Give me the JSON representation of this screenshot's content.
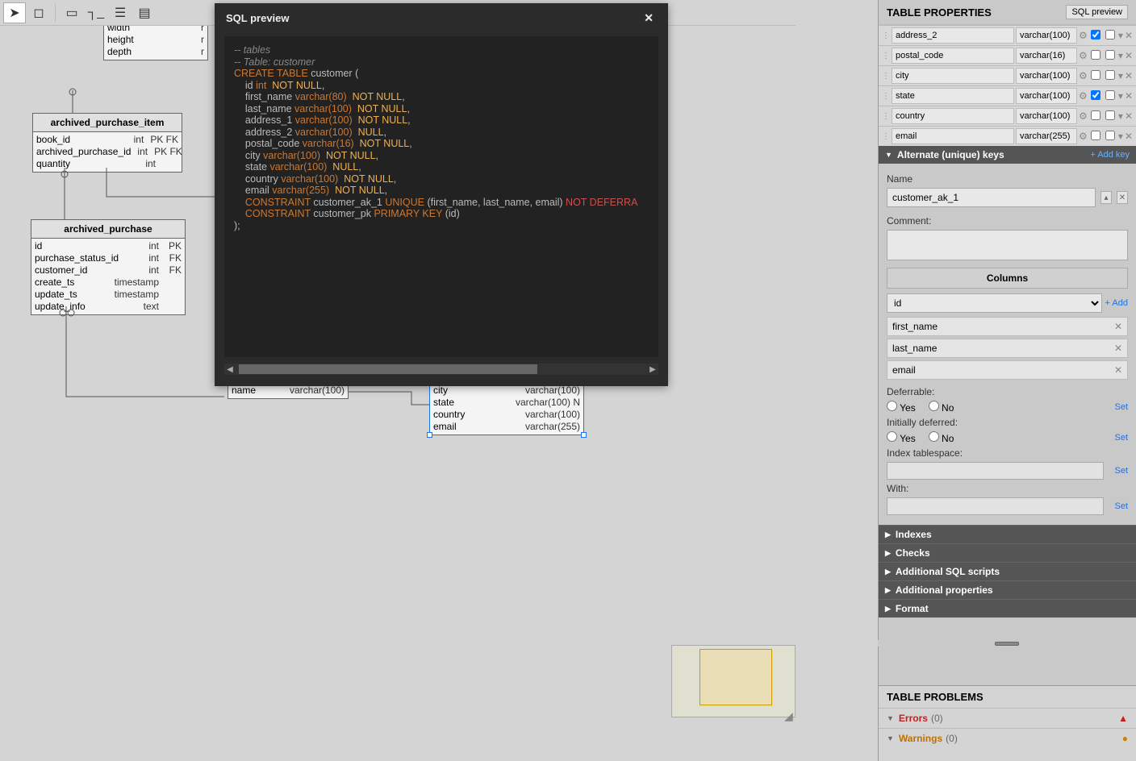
{
  "toolbar": {
    "tools": [
      "pointer",
      "marquee",
      "separator",
      "box",
      "connector",
      "list",
      "document"
    ]
  },
  "modal": {
    "title": "SQL preview",
    "code_lines": [
      {
        "t": "-- tables",
        "cls": "c-gray"
      },
      {
        "t": "-- Table: customer",
        "cls": "c-gray"
      },
      {
        "segments": [
          [
            "CREATE TABLE",
            "c-orange"
          ],
          [
            " ",
            ""
          ],
          [
            "customer (",
            "c-light"
          ]
        ]
      },
      {
        "segments": [
          [
            "    id ",
            "c-light"
          ],
          [
            "int",
            "c-orange"
          ],
          [
            "  ",
            ""
          ],
          [
            "NOT NULL",
            "c-yellow"
          ],
          [
            ",",
            "c-light"
          ]
        ]
      },
      {
        "segments": [
          [
            "    first_name ",
            "c-light"
          ],
          [
            "varchar(80)",
            "c-orange"
          ],
          [
            "  ",
            ""
          ],
          [
            "NOT NULL",
            "c-yellow"
          ],
          [
            ",",
            "c-light"
          ]
        ]
      },
      {
        "segments": [
          [
            "    last_name ",
            "c-light"
          ],
          [
            "varchar(100)",
            "c-orange"
          ],
          [
            "  ",
            ""
          ],
          [
            "NOT NULL",
            "c-yellow"
          ],
          [
            ",",
            "c-light"
          ]
        ]
      },
      {
        "segments": [
          [
            "    address_1 ",
            "c-light"
          ],
          [
            "varchar(100)",
            "c-orange"
          ],
          [
            "  ",
            ""
          ],
          [
            "NOT NULL",
            "c-yellow"
          ],
          [
            ",",
            "c-light"
          ]
        ]
      },
      {
        "segments": [
          [
            "    address_2 ",
            "c-light"
          ],
          [
            "varchar(100)",
            "c-orange"
          ],
          [
            "  ",
            ""
          ],
          [
            "NULL",
            "c-yellow"
          ],
          [
            ",",
            "c-light"
          ]
        ]
      },
      {
        "segments": [
          [
            "    postal_code ",
            "c-light"
          ],
          [
            "varchar(16)",
            "c-orange"
          ],
          [
            "  ",
            ""
          ],
          [
            "NOT NULL",
            "c-yellow"
          ],
          [
            ",",
            "c-light"
          ]
        ]
      },
      {
        "segments": [
          [
            "    city ",
            "c-light"
          ],
          [
            "varchar(100)",
            "c-orange"
          ],
          [
            "  ",
            ""
          ],
          [
            "NOT NULL",
            "c-yellow"
          ],
          [
            ",",
            "c-light"
          ]
        ]
      },
      {
        "segments": [
          [
            "    state ",
            "c-light"
          ],
          [
            "varchar(100)",
            "c-orange"
          ],
          [
            "  ",
            ""
          ],
          [
            "NULL",
            "c-yellow"
          ],
          [
            ",",
            "c-light"
          ]
        ]
      },
      {
        "segments": [
          [
            "    country ",
            "c-light"
          ],
          [
            "varchar(100)",
            "c-orange"
          ],
          [
            "  ",
            ""
          ],
          [
            "NOT NULL",
            "c-yellow"
          ],
          [
            ",",
            "c-light"
          ]
        ]
      },
      {
        "segments": [
          [
            "    email ",
            "c-light"
          ],
          [
            "varchar(255)",
            "c-orange"
          ],
          [
            "  ",
            ""
          ],
          [
            "NOT NULL",
            "c-yellow"
          ],
          [
            ",",
            "c-light"
          ]
        ]
      },
      {
        "segments": [
          [
            "    ",
            ""
          ],
          [
            "CONSTRAINT",
            "c-orange"
          ],
          [
            " customer_ak_1 ",
            "c-light"
          ],
          [
            "UNIQUE",
            "c-orange"
          ],
          [
            " (first_name, last_name, email) ",
            "c-light"
          ],
          [
            "NOT DEFERRA",
            "c-red"
          ]
        ]
      },
      {
        "segments": [
          [
            "    ",
            ""
          ],
          [
            "CONSTRAINT",
            "c-orange"
          ],
          [
            " customer_pk ",
            "c-light"
          ],
          [
            "PRIMARY KEY",
            "c-orange"
          ],
          [
            " (id)",
            "c-light"
          ]
        ]
      },
      {
        "t": ");",
        "cls": "c-light"
      }
    ]
  },
  "entities": {
    "partial_top": {
      "rows": [
        [
          "width",
          "r"
        ],
        [
          "height",
          "r"
        ],
        [
          "depth",
          "r"
        ]
      ]
    },
    "api": {
      "title": "archived_purchase_item",
      "rows": [
        [
          "book_id",
          "int",
          "PK FK"
        ],
        [
          "archived_purchase_id",
          "int",
          "PK FK"
        ],
        [
          "quantity",
          "int",
          ""
        ]
      ]
    },
    "ap": {
      "title": "archived_purchase",
      "rows": [
        [
          "id",
          "int",
          "PK"
        ],
        [
          "purchase_status_id",
          "int",
          "FK"
        ],
        [
          "customer_id",
          "int",
          "FK"
        ],
        [
          "create_ts",
          "timestamp",
          ""
        ],
        [
          "update_ts",
          "timestamp",
          ""
        ],
        [
          "update_info",
          "text",
          ""
        ]
      ]
    },
    "fragment1": {
      "rows": [
        [
          "name",
          "varchar(100)"
        ]
      ]
    },
    "fragment2": {
      "rows": [
        [
          "city",
          "varchar(100)"
        ],
        [
          "state",
          "varchar(100) N"
        ],
        [
          "country",
          "varchar(100)"
        ],
        [
          "email",
          "varchar(255)"
        ]
      ]
    }
  },
  "panel": {
    "title": "TABLE PROPERTIES",
    "sql_preview_btn": "SQL preview",
    "columns": [
      {
        "name": "address_2",
        "type": "varchar(100)",
        "pk": true,
        "nn": false
      },
      {
        "name": "postal_code",
        "type": "varchar(16)",
        "pk": false,
        "nn": false
      },
      {
        "name": "city",
        "type": "varchar(100)",
        "pk": false,
        "nn": false
      },
      {
        "name": "state",
        "type": "varchar(100)",
        "pk": true,
        "nn": false
      },
      {
        "name": "country",
        "type": "varchar(100)",
        "pk": false,
        "nn": false
      },
      {
        "name": "email",
        "type": "varchar(255)",
        "pk": false,
        "nn": false
      }
    ],
    "ak_section": "Alternate (unique) keys",
    "add_key": "+ Add key",
    "name_label": "Name",
    "name_value": "customer_ak_1",
    "comment_label": "Comment:",
    "columns_hdr": "Columns",
    "col_select": "id",
    "add": "+ Add",
    "selected_cols": [
      "first_name",
      "last_name",
      "email"
    ],
    "deferrable_label": "Deferrable:",
    "initially_label": "Initially deferred:",
    "yes": "Yes",
    "no": "No",
    "set": "Set",
    "index_ts_label": "Index tablespace:",
    "with_label": "With:",
    "sections": [
      "Indexes",
      "Checks",
      "Additional SQL scripts",
      "Additional properties",
      "Format"
    ]
  },
  "problems": {
    "title": "TABLE PROBLEMS",
    "errors_label": "Errors",
    "errors_count": "(0)",
    "warnings_label": "Warnings",
    "warnings_count": "(0)"
  }
}
